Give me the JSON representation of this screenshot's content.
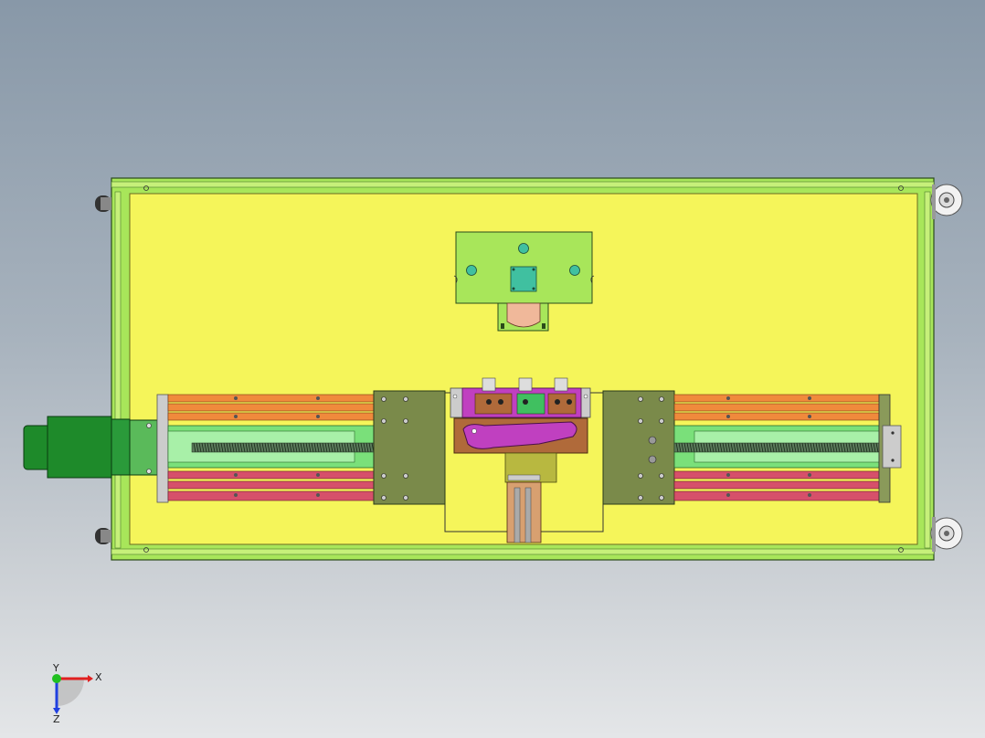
{
  "viewport": {
    "background_top": "#8898a8",
    "background_bottom": "#e4e6e8"
  },
  "model": {
    "colors": {
      "plate": "#f5f55a",
      "frame": "#a8e65a",
      "frame_dark": "#6a9a3a",
      "rail_orange": "#f08a3c",
      "rail_red": "#d6506a",
      "carriage": "#7a8a4a",
      "motor": "#1e8a2a",
      "tool_purple": "#c040c0",
      "tool_brown": "#b06a3a",
      "slide_green": "#7ae07a",
      "copper": "#f0b89a",
      "teal": "#40c0a0"
    }
  },
  "triad": {
    "x_label": "X",
    "y_label": "Y",
    "z_label": "Z",
    "x_color": "#e02020",
    "y_color": "#20c020",
    "z_color": "#2040e0"
  }
}
